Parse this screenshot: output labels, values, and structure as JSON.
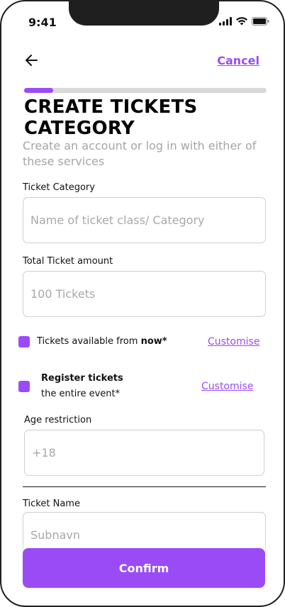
{
  "status_bar": {
    "time": "9:41"
  },
  "nav": {
    "cancel_label": "Cancel"
  },
  "progress": {
    "value": 0.12,
    "color": "#9b4bf6"
  },
  "header": {
    "title": "CREATE TICKETS CATEGORY",
    "subtitle": "Create an account or log in with either of these services"
  },
  "form": {
    "ticket_category": {
      "label": "Ticket Category",
      "placeholder": "Name of ticket class/ Category"
    },
    "total_ticket_amount": {
      "label": "Total Ticket amount",
      "placeholder": "100 Tickets"
    },
    "availability": {
      "text_prefix": "Tickets available from ",
      "text_bold": "now*",
      "link": "Customise"
    },
    "register": {
      "line1": "Register tickets",
      "line2": "the entire event*",
      "link": "Customise"
    },
    "age_restriction": {
      "label": "Age restriction",
      "placeholder": "+18"
    },
    "ticket_name": {
      "label": "Ticket Name",
      "placeholder": "Subnavn"
    }
  },
  "confirm_label": "Confirm",
  "colors": {
    "accent": "#9b4bf6"
  }
}
